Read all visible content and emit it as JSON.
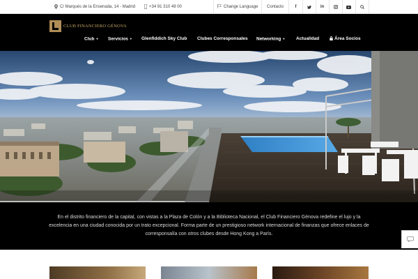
{
  "topbar": {
    "address": "C/ Marqués de la Ensenada, 14 - Madrid",
    "phone": "+34 91 310 49 00",
    "language": "Change Language",
    "contact": "Contacto"
  },
  "social_icons": [
    "facebook-icon",
    "twitter-icon",
    "linkedin-icon",
    "instagram-icon",
    "youtube-icon",
    "search-icon"
  ],
  "header": {
    "logo_text": "CLUB FINANCIERO GÉNOVA",
    "brand_color": "#b08d57"
  },
  "nav": {
    "club": "Club",
    "servicios": "Servicios",
    "sky_club": "Glenfiddich Sky Club",
    "corresponsales": "Clubes Corresponsales",
    "networking": "Networking",
    "actualidad": "Actualidad",
    "socios": "Área Socios"
  },
  "caption": {
    "text": "En el distrito financiero de la capital, con vistas a la Plaza de Colón y a la Biblioteca Nacional, el Club Financiero Génova redefine el lujo y la excelencia en una ciudad conocida por un trato excepcional. Forma parte de un prestigioso network internacional de finanzas que ofrece enlaces de corresponsalía con otros clubes desde Hong Kong a París."
  }
}
